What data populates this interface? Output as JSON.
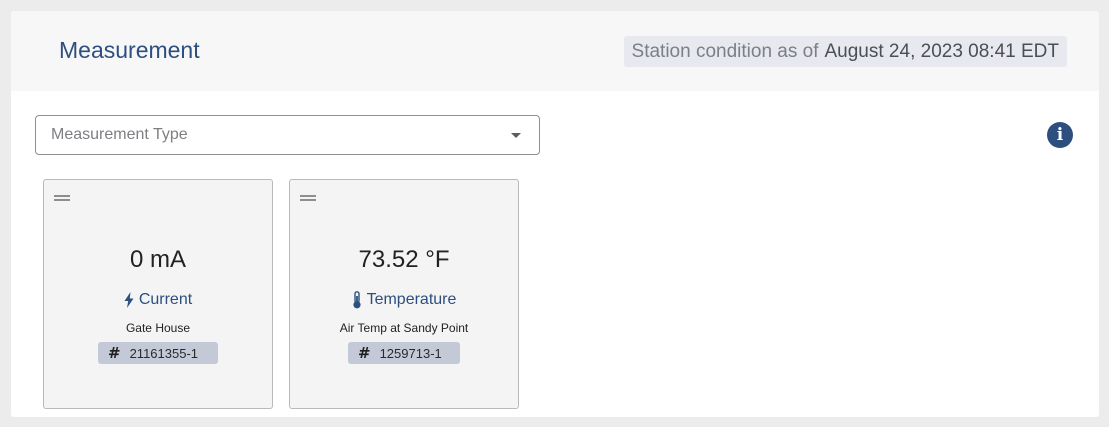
{
  "header": {
    "title": "Measurement",
    "status_prefix": "Station condition as of",
    "status_date": "August 24, 2023 08:41 EDT"
  },
  "filter": {
    "placeholder": "Measurement Type",
    "caret_icon": "caret-down-icon"
  },
  "info": {
    "icon": "info-icon",
    "glyph": "i"
  },
  "cards": [
    {
      "value": "0 mA",
      "type_label": "Current",
      "type_icon": "lightning-bolt-icon",
      "location": "Gate House",
      "serial": "21161355-1"
    },
    {
      "value": "73.52 °F",
      "type_label": "Temperature",
      "type_icon": "thermometer-icon",
      "location": "Air Temp at Sandy Point",
      "serial": "1259713-1"
    }
  ],
  "colors": {
    "accent": "#2d4f7f",
    "card_bg": "#f4f4f4",
    "chip_bg": "#c3c9d6",
    "status_chip_bg": "#e8e9ee"
  }
}
